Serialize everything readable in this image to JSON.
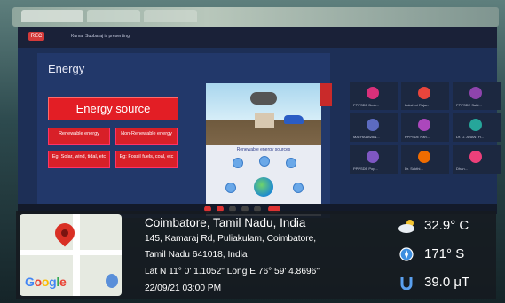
{
  "meeting": {
    "rec_label": "REC",
    "presenting_text": "Kumar Subbaraj is presenting"
  },
  "slide": {
    "title": "Energy",
    "energy_source": "Energy source",
    "boxes": [
      "Renewable energy",
      "Non-Renewable energy",
      "Eg: Solar, wind, tidal, etc",
      "Eg: Fossil fuels, coal, etc"
    ],
    "renewable_title": "Renewable energy sources"
  },
  "participants": [
    {
      "name": "PPPSDE Brah...",
      "color": "#d9307a"
    },
    {
      "name": "Lakshmi Rajan",
      "color": "#e8453c"
    },
    {
      "name": "PPPSDE Sahi...",
      "color": "#8e44ad"
    },
    {
      "name": "MATHALAVAN...",
      "color": "#5c6bc0"
    },
    {
      "name": "PPPSDE Nan...",
      "color": "#ab47bc"
    },
    {
      "name": "Dr. G. ANANTH...",
      "color": "#26a69a"
    },
    {
      "name": "PPPSDE Pop...",
      "color": "#7e57c2"
    },
    {
      "name": "Dr. Sakthi...",
      "color": "#ef6c00"
    },
    {
      "name": "Dhan...",
      "color": "#ec407a"
    }
  ],
  "gps": {
    "location": "Coimbatore, Tamil Nadu, India",
    "address1": "145, Kamaraj Rd, Puliakulam, Coimbatore,",
    "address2": "Tamil Nadu 641018, India",
    "coords": "Lat N 11° 0' 1.1052\" Long E 76° 59' 4.8696\"",
    "datetime": "22/09/21 03:00 PM",
    "map_logo": "Google",
    "temperature": "32.9° C",
    "heading": "171° S",
    "magnetic": "39.0 μT",
    "icons": [
      "map-pin-icon",
      "weather-cloud-icon",
      "compass-icon",
      "magnet-icon"
    ]
  }
}
